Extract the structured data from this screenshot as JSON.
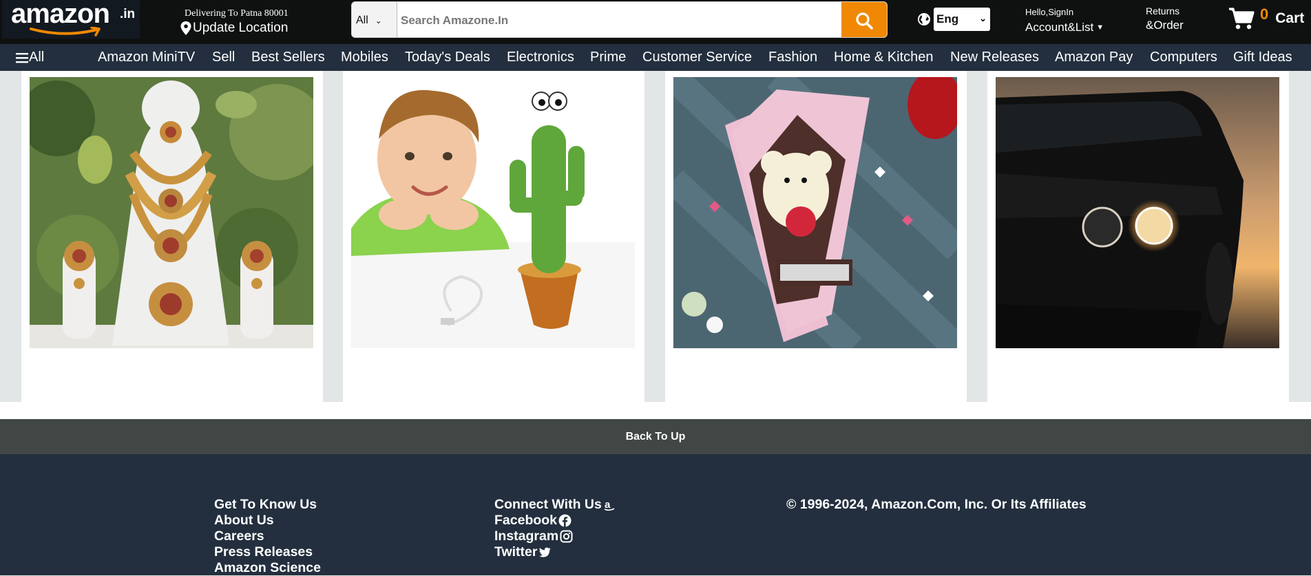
{
  "header": {
    "logo": {
      "word": "amazon",
      "tld": ".in"
    },
    "delivery": {
      "line1": "Delivering To Patna 80001",
      "line2": "Update Location"
    },
    "search": {
      "category": "All",
      "placeholder": "Search Amazone.In"
    },
    "language": {
      "value": "Eng"
    },
    "account": {
      "line1": "Hello,SignIn",
      "line2": "Account&List"
    },
    "returns": {
      "line1": "Returns",
      "line2": "&Order"
    },
    "cart": {
      "count": "0",
      "label": "Cart"
    }
  },
  "nav": {
    "all_label": "All",
    "items": [
      "Amazon MiniTV",
      "Sell",
      "Best Sellers",
      "Mobiles",
      "Today's Deals",
      "Electronics",
      "Prime",
      "Customer Service",
      "Fashion",
      "Home & Kitchen",
      "New Releases",
      "Amazon Pay",
      "Computers",
      "Gift Ideas"
    ]
  },
  "products": [
    {
      "icon": "jewellery-set-image"
    },
    {
      "icon": "dancing-cactus-toy-image"
    },
    {
      "icon": "teddy-love-frame-image"
    },
    {
      "icon": "black-car-image"
    }
  ],
  "back_to_top": "Back To Up",
  "footer": {
    "col1": [
      "Get To Know Us",
      "About Us",
      "Careers",
      "Press Releases",
      "Amazon Science"
    ],
    "col2": {
      "title": "Connect With Us",
      "links": [
        "Facebook",
        "Instagram",
        "Twitter"
      ]
    },
    "copyright": "© 1996-2024, Amazon.Com, Inc. Or Its Affiliates"
  },
  "colors": {
    "accent": "#f08804",
    "nav": "#232f3e",
    "header": "#0f1111",
    "backtop": "#414745"
  }
}
